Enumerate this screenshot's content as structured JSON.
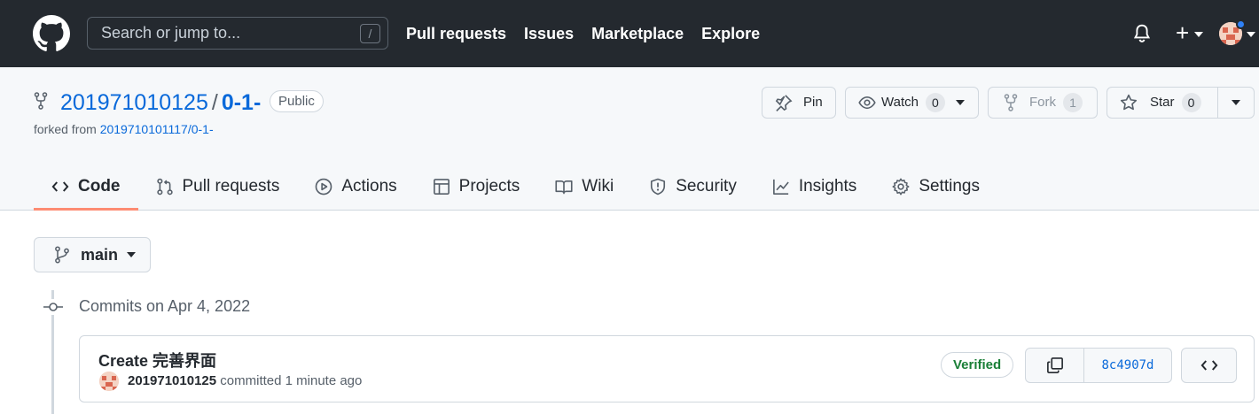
{
  "header": {
    "search_placeholder": "Search or jump to...",
    "search_shortcut": "/",
    "nav": [
      "Pull requests",
      "Issues",
      "Marketplace",
      "Explore"
    ],
    "plus_label": "+"
  },
  "repo": {
    "owner": "201971010125",
    "separator": "/",
    "name": "0-1-",
    "visibility": "Public",
    "forked_prefix": "forked from ",
    "forked_source": "2019710101117/0-1-",
    "pin_label": "Pin",
    "watch_label": "Watch",
    "watch_count": "0",
    "fork_label": "Fork",
    "fork_count": "1",
    "star_label": "Star",
    "star_count": "0"
  },
  "tabs": [
    {
      "label": "Code",
      "icon": "code-icon",
      "active": true
    },
    {
      "label": "Pull requests",
      "icon": "pull-request-icon"
    },
    {
      "label": "Actions",
      "icon": "play-icon"
    },
    {
      "label": "Projects",
      "icon": "table-icon"
    },
    {
      "label": "Wiki",
      "icon": "book-icon"
    },
    {
      "label": "Security",
      "icon": "shield-icon"
    },
    {
      "label": "Insights",
      "icon": "graph-icon"
    },
    {
      "label": "Settings",
      "icon": "gear-icon"
    }
  ],
  "branch": {
    "name": "main"
  },
  "commits": {
    "group_title": "Commits on Apr 4, 2022",
    "items": [
      {
        "title": "Create 完善界面",
        "author": "201971010125",
        "action": " committed ",
        "time": "1 minute ago",
        "verified": "Verified",
        "sha": "8c4907d"
      }
    ]
  },
  "colors": {
    "header_bg": "#24292f",
    "link": "#0969da",
    "active_tab_underline": "#fd8c73",
    "verified": "#1a7f37"
  }
}
